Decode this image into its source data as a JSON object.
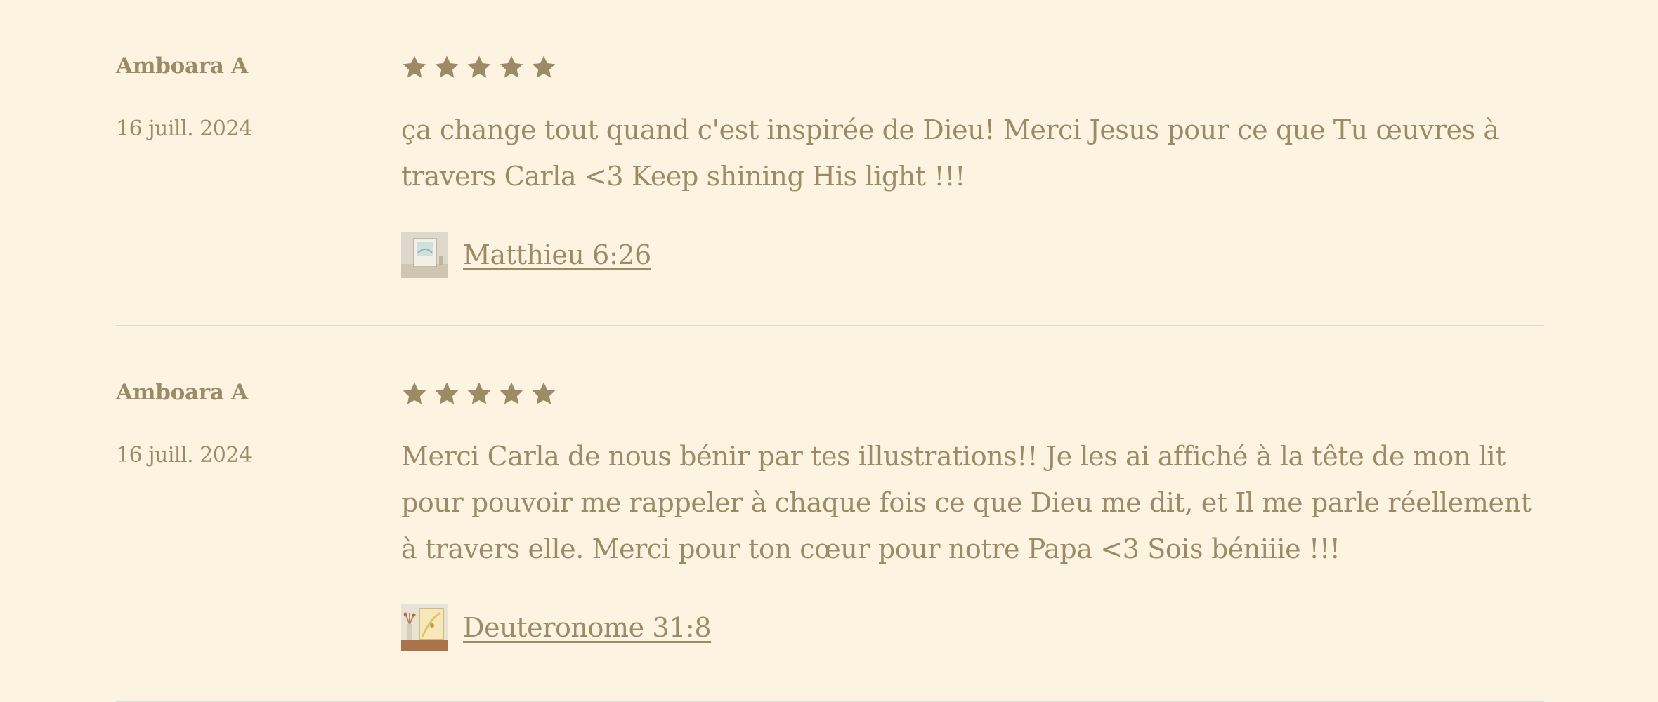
{
  "reviews": [
    {
      "author": "Amboara A",
      "date": "16 juill. 2024",
      "rating": 5,
      "text": "ça change tout quand c'est inspirée de Dieu! Merci Jesus pour ce que Tu œuvres à travers Carla <3 Keep shining His light !!!",
      "product": "Matthieu 6:26"
    },
    {
      "author": "Amboara A",
      "date": "16 juill. 2024",
      "rating": 5,
      "text": "Merci Carla de nous bénir par tes illustrations!! Je les ai affiché à la tête de mon lit pour pouvoir me rappeler à chaque fois ce que Dieu me dit, et Il me parle réellement à travers elle. Merci pour ton cœur pour notre Papa <3 Sois béniiie !!!",
      "product": "Deuteronome 31:8"
    }
  ],
  "colors": {
    "background": "#fdf3e1",
    "text": "#9c8b67",
    "star": "#9c8b67",
    "divider": "#d8dcd2"
  },
  "icons": {
    "star": "star-icon"
  }
}
